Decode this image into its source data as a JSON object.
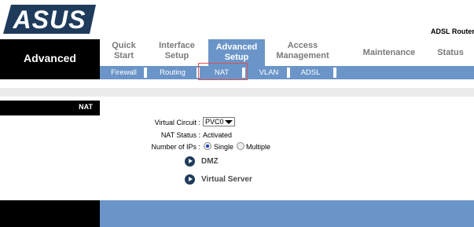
{
  "header": {
    "logo_text": "ASUS",
    "product": "ADSL Router"
  },
  "sidebar": {
    "title": "Advanced",
    "section": "NAT"
  },
  "nav": {
    "tabs": [
      {
        "line1": "Quick",
        "line2": "Start"
      },
      {
        "line1": "Interface",
        "line2": "Setup"
      },
      {
        "line1": "Advanced",
        "line2": "Setup"
      },
      {
        "line1": "Access",
        "line2": "Management"
      },
      {
        "line1": "Maintenance",
        "line2": ""
      },
      {
        "line1": "Status",
        "line2": ""
      }
    ],
    "active_tab": "Advanced Setup",
    "subtabs": [
      "Firewall",
      "Routing",
      "NAT",
      "VLAN",
      "ADSL"
    ],
    "active_subtab": "NAT"
  },
  "form": {
    "virtual_circuit_label": "Virtual Circuit :",
    "virtual_circuit_value": "PVC0",
    "nat_status_label": "NAT Status :",
    "nat_status_value": "Activated",
    "num_ips_label": "Number of IPs :",
    "num_ips_options": [
      "Single",
      "Multiple"
    ],
    "num_ips_selected": "Single"
  },
  "links": {
    "dmz": "DMZ",
    "virtual_server": "Virtual Server"
  },
  "colors": {
    "accent_blue": "#6b95c8",
    "black": "#000000",
    "grey_band": "#ececec",
    "highlight_red": "#e05050"
  }
}
